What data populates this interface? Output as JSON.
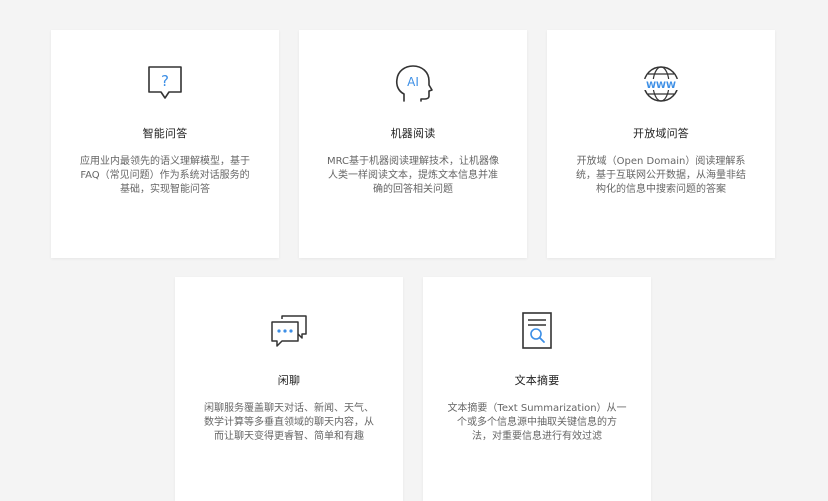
{
  "cards": [
    {
      "icon": "question-bubble-icon",
      "title": "智能问答",
      "desc_lines": [
        "应用业内最领先的语义理解模型，基于",
        "FAQ（常见问题）作为系统对话服务的",
        "基础，实现智能问答"
      ]
    },
    {
      "icon": "ai-head-icon",
      "icon_text": "AI",
      "title": "机器阅读",
      "desc_lines": [
        "MRC基于机器阅读理解技术，让机器像",
        "人类一样阅读文本，提炼文本信息并准",
        "确的回答相关问题"
      ]
    },
    {
      "icon": "globe-www-icon",
      "icon_text": "WWW",
      "title": "开放域问答",
      "desc_lines": [
        "开放域（Open Domain）阅读理解系",
        "统，基于互联网公开数据，从海量非结",
        "构化的信息中搜索问题的答案"
      ]
    },
    {
      "icon": "chat-bubbles-icon",
      "title": "闲聊",
      "desc_lines": [
        "闲聊服务覆盖聊天对话、新闻、天气、",
        "数学计算等多垂直领域的聊天内容，从",
        "而让聊天变得更睿智、简单和有趣"
      ]
    },
    {
      "icon": "document-search-icon",
      "title": "文本摘要",
      "desc_lines": [
        "文本摘要（Text Summarization）从一",
        "个或多个信息源中抽取关键信息的方",
        "法，对重要信息进行有效过滤"
      ]
    }
  ],
  "colors": {
    "background": "#f4f4f4",
    "card": "#ffffff",
    "icon_stroke": "#333333",
    "accent": "#3d8fe6"
  }
}
